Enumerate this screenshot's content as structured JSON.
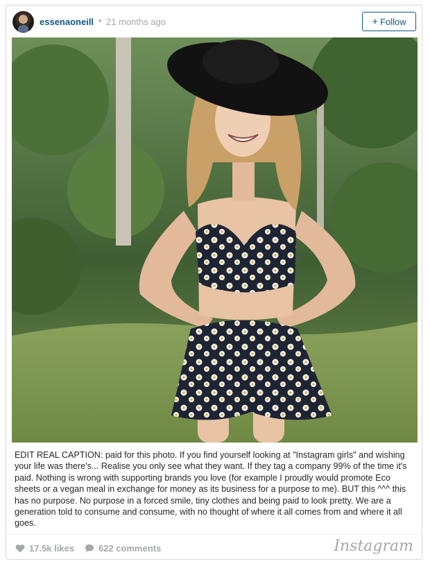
{
  "post": {
    "username": "essenaoneill",
    "separator": "•",
    "timestamp": "21 months ago",
    "follow_label": "Follow",
    "follow_prefix": "+",
    "caption": "EDIT REAL CAPTION: paid for this photo. If you find yourself looking at \"Instagram girls\" and wishing your life was there's... Realise you only see what they want. If they tag a company 99% of the time it's paid. Nothing is wrong with supporting brands you love (for example I proudly would promote Eco sheets or a vegan meal in exchange for money as its business for a purpose to me). BUT this ^^^ this has no purpose. No purpose in a forced smile, tiny clothes and being paid to look pretty. We are a generation told to consume and consume, with no thought of where it all comes from and where it all goes.",
    "likes": "17.5k likes",
    "comments": "622 comments",
    "brand": "Instagram"
  },
  "icons": {
    "avatar": "profile-avatar",
    "likes": "heart-icon",
    "comments": "comment-bubble-icon"
  },
  "colors": {
    "accent": "#125688",
    "muted": "#a5a7aa"
  }
}
